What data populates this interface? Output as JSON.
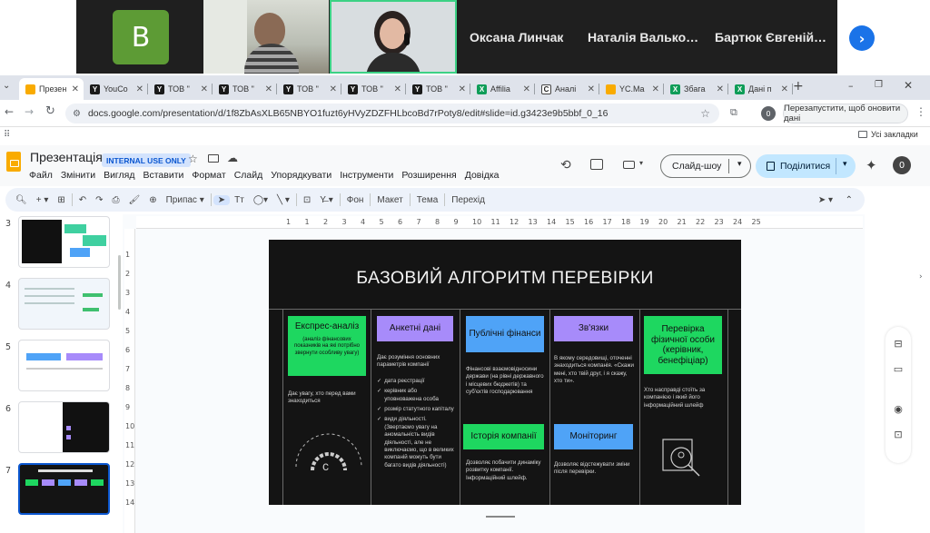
{
  "meeting": {
    "avatar_letter": "B",
    "participants": [
      "Оксана Линчак",
      "Наталія Валько…",
      "Бартюк Євгеній…"
    ],
    "next_icon": "chevron-right-icon"
  },
  "tabs": [
    {
      "label": "Презен",
      "active": true,
      "fav_color": "#f9ab00",
      "fav_text": ""
    },
    {
      "label": "YouCo",
      "fav_color": "#1a1a1a",
      "fav_text": "Y"
    },
    {
      "label": "ТОВ \"",
      "fav_color": "#1a1a1a",
      "fav_text": "Y"
    },
    {
      "label": "ТОВ \"",
      "fav_color": "#1a1a1a",
      "fav_text": "Y"
    },
    {
      "label": "ТОВ \"",
      "fav_color": "#1a1a1a",
      "fav_text": "Y"
    },
    {
      "label": "ТОВ \"",
      "fav_color": "#1a1a1a",
      "fav_text": "Y"
    },
    {
      "label": "ТОВ \"",
      "fav_color": "#1a1a1a",
      "fav_text": "Y"
    },
    {
      "label": "Affilia",
      "fav_color": "#0f9d58",
      "fav_text": "X"
    },
    {
      "label": "Аналі",
      "fav_color": "#ffffff",
      "fav_text": "C"
    },
    {
      "label": "YC.Ma",
      "fav_color": "#f9ab00",
      "fav_text": ""
    },
    {
      "label": "Збага",
      "fav_color": "#0f9d58",
      "fav_text": "X"
    },
    {
      "label": "Дані п",
      "fav_color": "#0f9d58",
      "fav_text": "X"
    }
  ],
  "address": {
    "url": "docs.google.com/presentation/d/1f8ZbAsXLB65NBYO1fuzt6yHVyZDZFHLbcoBd7rPoty8/edit#slide=id.g3423e9b5bbf_0_16",
    "profile_letter": "0",
    "restart_label": "Перезапустити, щоб оновити дані",
    "bookmarks_label": "Усі закладки"
  },
  "app": {
    "title": "Презентація",
    "badge": "INTERNAL USE ONLY",
    "menu": [
      "Файл",
      "Змінити",
      "Вигляд",
      "Вставити",
      "Формат",
      "Слайд",
      "Упорядкувати",
      "Інструменти",
      "Розширення",
      "Довідка"
    ],
    "slideshow_label": "Слайд-шоу",
    "share_label": "Поділитися",
    "profile_letter": "0"
  },
  "toolbar": {
    "zoom_label": "Припас",
    "font_label": "Тт",
    "background_label": "Фон",
    "layout_label": "Макет",
    "theme_label": "Тема",
    "transition_label": "Перехід"
  },
  "filmstrip": {
    "numbers": [
      "3",
      "4",
      "5",
      "6",
      "7"
    ]
  },
  "ruler": {
    "h_ticks": [
      "1",
      "1",
      "2",
      "3",
      "4",
      "5",
      "6",
      "7",
      "8",
      "9",
      "10",
      "11",
      "12",
      "13",
      "14",
      "15",
      "16",
      "17",
      "18",
      "19",
      "20",
      "21",
      "22",
      "23",
      "24",
      "25"
    ],
    "v_ticks": [
      "1",
      "2",
      "3",
      "4",
      "5",
      "6",
      "7",
      "8",
      "9",
      "10",
      "11",
      "12",
      "13",
      "14"
    ]
  },
  "slide": {
    "title": "БАЗОВИЙ АЛГОРИТМ ПЕРЕВІРКИ",
    "col1": {
      "box_title": "Експрес-аналіз",
      "box_sub": "(аналіз фінансових показників на які потрібно звернути особливу увагу)",
      "text": "Дає увагу, хто перед вами знаходиться"
    },
    "col2": {
      "box_title": "Анкетні дані",
      "text": "Дає розуміння основних параметрів компанії",
      "items": [
        "дата реєстрації",
        "керівник або уповноважена особа",
        "розмір статутного капіталу",
        "види діяльності. (Звертаємо увагу на аномальність видів діяльності, але не виключаємо, що в великих компаній можуть бути багато видів діяльності)"
      ]
    },
    "col3": {
      "box_title": "Публічні фінанси",
      "text": "Фінансові взаємовідносини держави (на рівні державного і місцевих бюджетів) та суб'єктів господарювання",
      "box2_title": "Історія компанії",
      "text2": "Дозволяє побачити динаміку розвитку компанії. Інформаційний шлейф."
    },
    "col4": {
      "box_title": "Зв'язки",
      "text": "В якому середовищі, оточенні знаходиться компанія. «Скажи мені, хто твій друг, і я скажу, хто ти».",
      "box2_title": "Моніторинг",
      "text2": "Дозволяє відстежувати зміни після перевірки."
    },
    "col5": {
      "box_title": "Перевірка фізичної особи (керівник, бенефіціар)",
      "text": "Хто насправді стоїть за компанією і який його інформаційний шлейф"
    },
    "colors": {
      "green": "#1ed760",
      "purple": "#a78bfa",
      "blue": "#4fa3f7"
    }
  }
}
